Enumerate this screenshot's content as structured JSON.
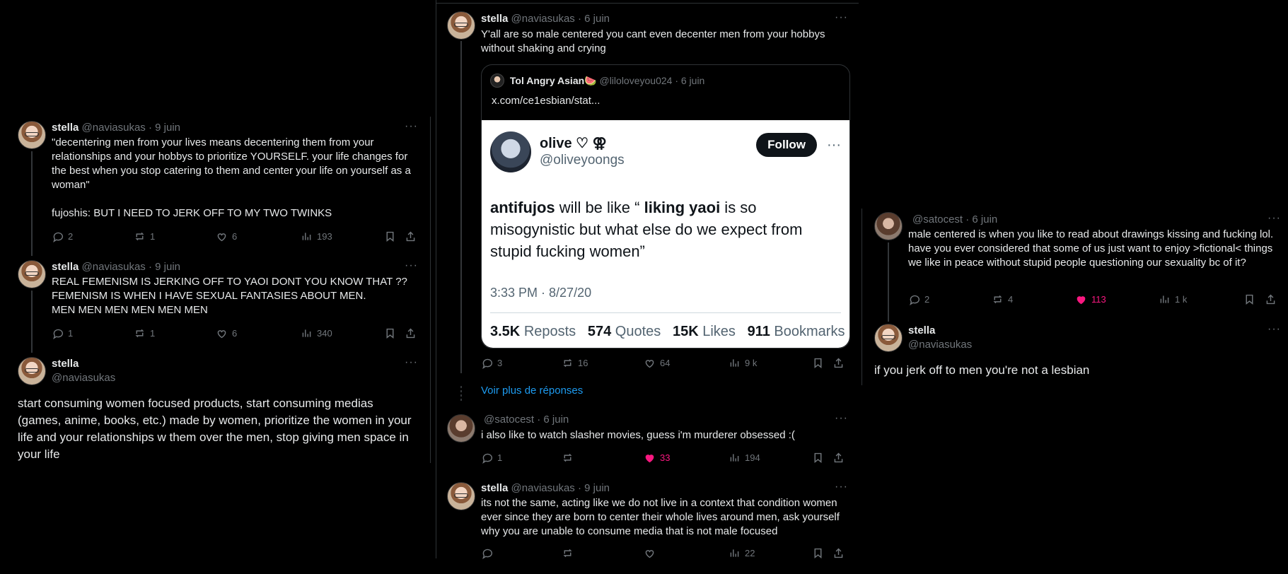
{
  "left": {
    "tweets": [
      {
        "name": "stella",
        "meta": "@naviasukas · 9 juin",
        "text": "\"decentering men from your lives means decentering them from your relationships and your hobbys to prioritize YOURSELF. your life changes for the best when you stop catering to them and center your life on yourself as a woman\"",
        "text2": "fujoshis: BUT I NEED TO JERK OFF TO MY TWO TWINKS",
        "replies": "2",
        "reposts": "1",
        "likes": "6",
        "views": "193"
      },
      {
        "name": "stella",
        "meta": "@naviasukas · 9 juin",
        "line1": "REAL FEMENISM IS JERKING OFF TO YAOI DONT YOU KNOW THAT ??",
        "line2": "FEMENISM IS WHEN I HAVE SEXUAL FANTASIES ABOUT MEN.",
        "line3": "MEN MEN MEN MEN MEN MEN",
        "replies": "1",
        "reposts": "1",
        "likes": "6",
        "views": "340"
      },
      {
        "name": "stella",
        "handle": "@naviasukas",
        "text": "start consuming women focused products, start consuming medias (games, anime, books, etc.) made by women, prioritize the women in your life and your relationships w them over the men, stop giving men space in your life"
      }
    ]
  },
  "middle": {
    "main": {
      "name": "stella",
      "meta": "@naviasukas · 6 juin",
      "text": "Y'all are so male centered you cant even decenter men from your hobbys without shaking and crying",
      "replies": "3",
      "reposts": "16",
      "likes": "64",
      "views": "9 k"
    },
    "quote": {
      "name": "Tol Angry Asian🍉",
      "meta": "@liloloveyou024 · 6 juin",
      "link": "x.com/ce1esbian/stat...",
      "card": {
        "name": "olive ♡ ⚢",
        "handle": "@oliveyoongs",
        "follow": "Follow",
        "b1": "antifujos",
        "t1": " will be like “ ",
        "b2": "liking yaoi",
        "t2": "  is so misogynistic but what else do we expect from stupid fucking women”",
        "time": "3:33 PM · 8/27/20",
        "reposts_n": "3.5K",
        "reposts_l": "Reposts",
        "quotes_n": "574",
        "quotes_l": "Quotes",
        "likes_n": "15K",
        "likes_l": "Likes",
        "bookmarks_n": "911",
        "bookmarks_l": "Bookmarks"
      }
    },
    "more_replies": "Voir plus de réponses",
    "reply1": {
      "meta": "@satocest · 6 juin",
      "text": "i also like to watch slasher movies, guess i'm murderer obsessed :(",
      "replies": "1",
      "reposts": "",
      "likes": "33",
      "views": "194"
    },
    "reply2": {
      "name": "stella",
      "meta": "@naviasukas · 9 juin",
      "text": "its not the same, acting like we do not live in a context that condition women ever since they are born to center their whole lives around men, ask yourself why you are unable to consume media that is not male focused",
      "views": "22"
    }
  },
  "right": {
    "reply": {
      "meta": "@satocest · 6 juin",
      "text": "male centered is when you like to read about drawings kissing and fucking lol. have you ever considered that some of us just want to enjoy >fictional< things we like in peace without stupid people questioning our sexuality bc of it?",
      "replies": "2",
      "reposts": "4",
      "likes": "113",
      "views": "1 k"
    },
    "main": {
      "name": "stella",
      "handle": "@naviasukas",
      "text": "if you jerk off to men you're not a lesbian"
    }
  },
  "colors": {
    "accent": "#1d9bf0",
    "like": "#f91880",
    "muted": "#71767b"
  }
}
